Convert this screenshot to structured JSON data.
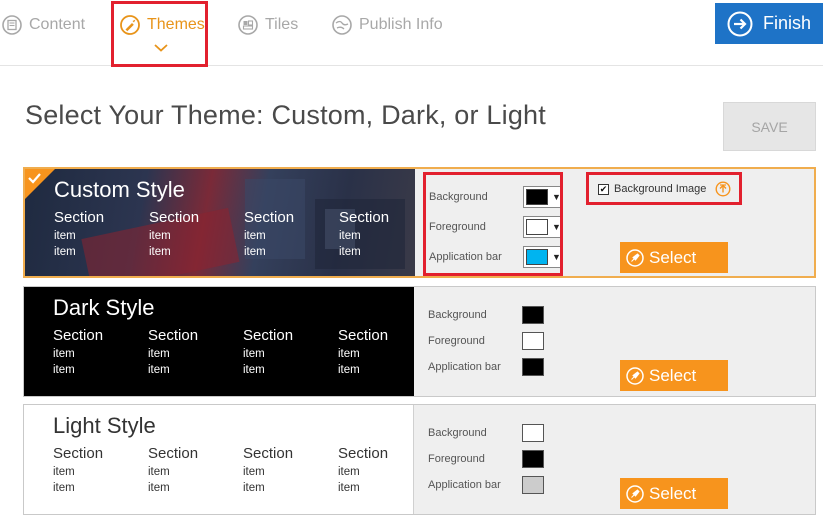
{
  "nav": {
    "tabs": [
      {
        "label": "Content",
        "icon": "content-icon"
      },
      {
        "label": "Themes",
        "icon": "themes-icon"
      },
      {
        "label": "Tiles",
        "icon": "tiles-icon"
      },
      {
        "label": "Publish Info",
        "icon": "publish-info-icon"
      }
    ],
    "active_tab": "Themes",
    "finish_label": "Finish"
  },
  "page": {
    "title": "Select Your Theme: Custom, Dark, or Light",
    "save_label": "SAVE"
  },
  "themes": [
    {
      "name": "Custom Style",
      "selected": true,
      "sections": [
        {
          "head": "Section",
          "items": [
            "item",
            "item"
          ]
        },
        {
          "head": "Section",
          "items": [
            "item",
            "item"
          ]
        },
        {
          "head": "Section",
          "items": [
            "item",
            "item"
          ]
        },
        {
          "head": "Section",
          "items": [
            "item",
            "item"
          ]
        }
      ],
      "colors": [
        {
          "label": "Background",
          "value": "#000000"
        },
        {
          "label": "Foreground",
          "value": "#ffffff"
        },
        {
          "label": "Application bar",
          "value": "#00b4f0"
        }
      ],
      "background_image_label": "Background Image",
      "background_image_checked": true,
      "select_label": "Select"
    },
    {
      "name": "Dark Style",
      "sections": [
        {
          "head": "Section",
          "items": [
            "item",
            "item"
          ]
        },
        {
          "head": "Section",
          "items": [
            "item",
            "item"
          ]
        },
        {
          "head": "Section",
          "items": [
            "item",
            "item"
          ]
        },
        {
          "head": "Section",
          "items": [
            "item",
            "item"
          ]
        }
      ],
      "colors": [
        {
          "label": "Background",
          "value": "#000000"
        },
        {
          "label": "Foreground",
          "value": "#ffffff"
        },
        {
          "label": "Application bar",
          "value": "#000000"
        }
      ],
      "select_label": "Select"
    },
    {
      "name": "Light Style",
      "sections": [
        {
          "head": "Section",
          "items": [
            "item",
            "item"
          ]
        },
        {
          "head": "Section",
          "items": [
            "item",
            "item"
          ]
        },
        {
          "head": "Section",
          "items": [
            "item",
            "item"
          ]
        },
        {
          "head": "Section",
          "items": [
            "item",
            "item"
          ]
        }
      ],
      "colors": [
        {
          "label": "Background",
          "value": "#ffffff"
        },
        {
          "label": "Foreground",
          "value": "#000000"
        },
        {
          "label": "Application bar",
          "value": "#cccccc"
        }
      ],
      "select_label": "Select"
    }
  ],
  "accent_colors": {
    "orange": "#f7941d",
    "finish_blue": "#1e73c7",
    "annotation_red": "#e2202e"
  }
}
